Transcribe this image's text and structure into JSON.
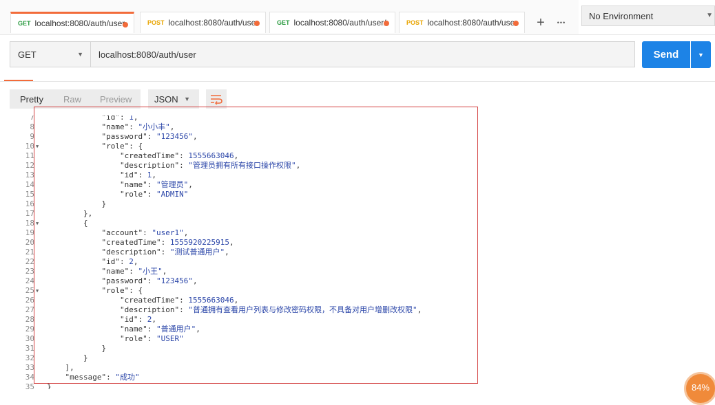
{
  "tabs": [
    {
      "method": "GET",
      "url": "localhost:8080/auth/user",
      "active": true
    },
    {
      "method": "POST",
      "url": "localhost:8080/auth/use",
      "active": false
    },
    {
      "method": "GET",
      "url": "localhost:8080/auth/user/",
      "active": false
    },
    {
      "method": "POST",
      "url": "localhost:8080/auth/use",
      "active": false
    }
  ],
  "tab_actions": {
    "add": "+",
    "more": "•••"
  },
  "environment": {
    "selected": "No Environment"
  },
  "request": {
    "method": "GET",
    "url": "localhost:8080/auth/user",
    "send_label": "Send"
  },
  "response": {
    "views": {
      "pretty": "Pretty",
      "raw": "Raw",
      "preview": "Preview"
    },
    "format": "JSON",
    "lines": [
      {
        "n": "7",
        "fold": false,
        "indent": 4,
        "text": "\"id\": 1,",
        "partial": true
      },
      {
        "n": "8",
        "fold": false,
        "indent": 4,
        "text": "\"name\": \"小小丰\","
      },
      {
        "n": "9",
        "fold": false,
        "indent": 4,
        "text": "\"password\": \"123456\","
      },
      {
        "n": "10",
        "fold": true,
        "indent": 4,
        "text": "\"role\": {"
      },
      {
        "n": "11",
        "fold": false,
        "indent": 5,
        "text": "\"createdTime\": 1555663046,"
      },
      {
        "n": "12",
        "fold": false,
        "indent": 5,
        "text": "\"description\": \"管理员拥有所有接口操作权限\","
      },
      {
        "n": "13",
        "fold": false,
        "indent": 5,
        "text": "\"id\": 1,"
      },
      {
        "n": "14",
        "fold": false,
        "indent": 5,
        "text": "\"name\": \"管理员\","
      },
      {
        "n": "15",
        "fold": false,
        "indent": 5,
        "text": "\"role\": \"ADMIN\""
      },
      {
        "n": "16",
        "fold": false,
        "indent": 4,
        "text": "}"
      },
      {
        "n": "17",
        "fold": false,
        "indent": 3,
        "text": "},"
      },
      {
        "n": "18",
        "fold": true,
        "indent": 3,
        "text": "{"
      },
      {
        "n": "19",
        "fold": false,
        "indent": 4,
        "text": "\"account\": \"user1\","
      },
      {
        "n": "20",
        "fold": false,
        "indent": 4,
        "text": "\"createdTime\": 1555920225915,"
      },
      {
        "n": "21",
        "fold": false,
        "indent": 4,
        "text": "\"description\": \"测试普通用户\","
      },
      {
        "n": "22",
        "fold": false,
        "indent": 4,
        "text": "\"id\": 2,"
      },
      {
        "n": "23",
        "fold": false,
        "indent": 4,
        "text": "\"name\": \"小王\","
      },
      {
        "n": "24",
        "fold": false,
        "indent": 4,
        "text": "\"password\": \"123456\","
      },
      {
        "n": "25",
        "fold": true,
        "indent": 4,
        "text": "\"role\": {"
      },
      {
        "n": "26",
        "fold": false,
        "indent": 5,
        "text": "\"createdTime\": 1555663046,"
      },
      {
        "n": "27",
        "fold": false,
        "indent": 5,
        "text": "\"description\": \"普通拥有查看用户列表与修改密码权限，不具备对用户增删改权限\","
      },
      {
        "n": "28",
        "fold": false,
        "indent": 5,
        "text": "\"id\": 2,"
      },
      {
        "n": "29",
        "fold": false,
        "indent": 5,
        "text": "\"name\": \"普通用户\","
      },
      {
        "n": "30",
        "fold": false,
        "indent": 5,
        "text": "\"role\": \"USER\""
      },
      {
        "n": "31",
        "fold": false,
        "indent": 4,
        "text": "}"
      },
      {
        "n": "32",
        "fold": false,
        "indent": 3,
        "text": "}"
      },
      {
        "n": "33",
        "fold": false,
        "indent": 2,
        "text": "],"
      },
      {
        "n": "34",
        "fold": false,
        "indent": 2,
        "text": "\"message\": \"成功\""
      },
      {
        "n": "35",
        "fold": false,
        "indent": 1,
        "text": "}"
      }
    ]
  },
  "badge": {
    "text": "84%"
  },
  "colors": {
    "accent": "#f26b3a",
    "send": "#1d83e6",
    "highlight_box": "#d23b3b",
    "string": "#2a45a8"
  }
}
